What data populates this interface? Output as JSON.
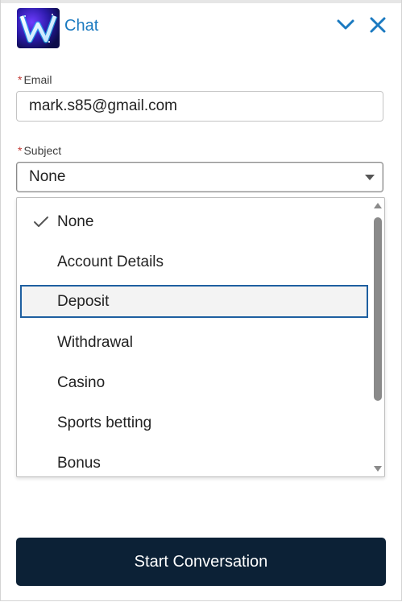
{
  "header": {
    "title": "Chat",
    "logo_letter": "W",
    "minimize_icon": "chevron-down-icon",
    "close_icon": "close-icon",
    "accent_color": "#1b7ac0"
  },
  "form": {
    "required_marker": "*",
    "email": {
      "label": "Email",
      "value": "mark.s85@gmail.com"
    },
    "subject": {
      "label": "Subject",
      "value": "None",
      "options": [
        {
          "label": "None",
          "checked": true
        },
        {
          "label": "Account Details"
        },
        {
          "label": "Deposit",
          "focused": true
        },
        {
          "label": "Withdrawal"
        },
        {
          "label": "Casino"
        },
        {
          "label": "Sports betting"
        },
        {
          "label": "Bonus"
        }
      ]
    }
  },
  "footer": {
    "start_button_label": "Start Conversation",
    "button_color": "#0c2136"
  }
}
